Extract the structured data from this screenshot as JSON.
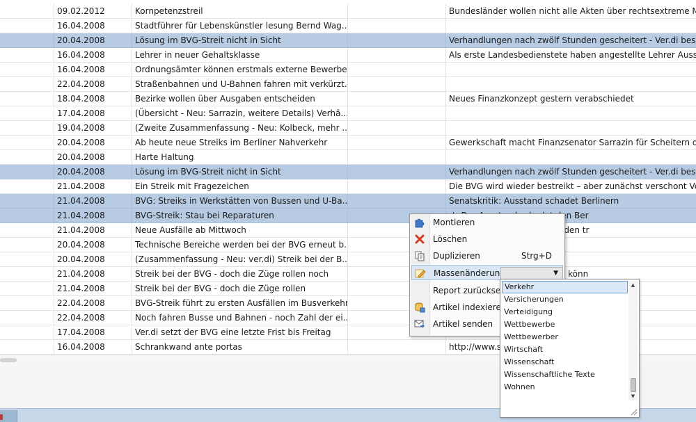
{
  "grid": {
    "rows": [
      {
        "date": "09.02.2012",
        "title": "Kornpetenzstreil",
        "extra": "",
        "note": "Bundesländer wollen nicht alle Akten über rechtsextreme Mord",
        "selected": false
      },
      {
        "date": "16.04.2008",
        "title": "Stadtführer für Lebenskünstler  lesung Bernd Wag...",
        "extra": "",
        "note": "",
        "selected": false
      },
      {
        "date": "20.04.2008",
        "title": "Lösung im BVG-Streit nicht in Sicht",
        "extra": "",
        "note": "Verhandlungen nach zwölf Stunden gescheitert - Ver.di beschu",
        "selected": true
      },
      {
        "date": "16.04.2008",
        "title": "Lehrer in neuer Gehaltsklasse",
        "extra": "",
        "note": "Als erste Landesbedienstete haben angestellte Lehrer Aussicht",
        "selected": false
      },
      {
        "date": "16.04.2008",
        "title": "Ordnungsämter können erstmals externe Bewerbe...",
        "extra": "",
        "note": "",
        "selected": false
      },
      {
        "date": "22.04.2008",
        "title": "Straßenbahnen und U-Bahnen fahren mit verkürzt...",
        "extra": "",
        "note": "",
        "selected": false
      },
      {
        "date": "18.04.2008",
        "title": "Bezirke wollen über Ausgaben entscheiden",
        "extra": "",
        "note": "Neues Finanzkonzept gestern verabschiedet",
        "selected": false
      },
      {
        "date": "17.04.2008",
        "title": "(Übersicht - Neu: Sarrazin, weitere Details) Verhä...",
        "extra": "",
        "note": "",
        "selected": false
      },
      {
        "date": "19.04.2008",
        "title": "(Zweite Zusammenfassung - Neu: Kolbeck, mehr ...",
        "extra": "",
        "note": "",
        "selected": false
      },
      {
        "date": "20.04.2008",
        "title": "Ab heute neue Streiks im Berliner Nahverkehr",
        "extra": "",
        "note": "Gewerkschaft macht Finanzsenator Sarrazin für Scheitern der",
        "selected": false
      },
      {
        "date": "20.04.2008",
        "title": "Harte Haltung",
        "extra": "",
        "note": "",
        "selected": false
      },
      {
        "date": "20.04.2008",
        "title": "Lösung im BVG-Streit nicht in Sicht",
        "extra": "",
        "note": "Verhandlungen nach zwölf Stunden gescheitert - Ver.di beschu",
        "selected": true
      },
      {
        "date": "21.04.2008",
        "title": "Ein Streik mit Fragezeichen",
        "extra": "",
        "note": "Die BVG wird wieder bestreikt – aber zunächst verschont Ver.",
        "selected": false
      },
      {
        "date": "21.04.2008",
        "title": "BVG: Streiks in Werkstätten von Bussen und U-Ba...",
        "extra": "",
        "note": "Senatskritik: Ausstand schadet Berlinern",
        "selected": true
      },
      {
        "date": "21.04.2008",
        "title": "BVG-Streik: Stau bei Reparaturen",
        "extra": "",
        "note": "rt: Der Ausstand schadet den Ber",
        "selected": true
      },
      {
        "date": "21.04.2008",
        "title": "Neue Ausfälle ab Mittwoch",
        "extra": "",
        "note": "rkstätten wird auch die Kunden tr",
        "selected": false
      },
      {
        "date": "20.04.2008",
        "title": "Technische Bereiche werden bei der BVG erneut b...",
        "extra": "",
        "note": "",
        "selected": false
      },
      {
        "date": "20.04.2008",
        "title": "(Zusammenfassung - Neu: ver.di) Streik bei der B...",
        "extra": "",
        "note": "",
        "selected": false
      },
      {
        "date": "21.04.2008",
        "title": "Streik bei der BVG - doch die Züge rollen noch",
        "extra": "",
        "note": "et im Ausstand Ab Dienstag könn",
        "selected": false
      },
      {
        "date": "21.04.2008",
        "title": "Streik bei der BVG - doch die Züge rollen",
        "extra": "",
        "note": "Dienstag könn",
        "selected": false
      },
      {
        "date": "22.04.2008",
        "title": "BVG-Streik führt zu ersten Ausfällen im Busverkehr",
        "extra": "",
        "note": "",
        "selected": false
      },
      {
        "date": "22.04.2008",
        "title": "Noch fahren Busse und Bahnen - noch  Zahl der ei...",
        "extra": "",
        "note": "",
        "selected": false
      },
      {
        "date": "17.04.2008",
        "title": "Ver.di setzt der BVG eine letzte Frist bis Freitag",
        "extra": "",
        "note": "",
        "selected": false
      },
      {
        "date": "16.04.2008",
        "title": "Schrankwand ante portas",
        "extra": "",
        "note": "http://www.s                    8,547665,00.h",
        "selected": false
      }
    ]
  },
  "context_menu": {
    "items": [
      {
        "label": "Montieren",
        "shortcut": "",
        "icon": "puzzle-icon"
      },
      {
        "label": "Löschen",
        "shortcut": "",
        "icon": "delete-x-icon"
      },
      {
        "label": "Duplizieren",
        "shortcut": "Strg+D",
        "icon": "duplicate-icon"
      },
      {
        "label": "Massenänderung",
        "shortcut": "",
        "icon": "pencil-edit-icon"
      },
      {
        "label": "Report zurücksetzen",
        "shortcut": "",
        "icon": ""
      },
      {
        "label": "Artikel indexieren",
        "shortcut": "",
        "icon": "index-database-icon"
      },
      {
        "label": "Artikel senden",
        "shortcut": "",
        "icon": "send-mail-icon"
      }
    ],
    "highlighted_index": 3
  },
  "dropdown": {
    "options": [
      "Verkehr",
      "Versicherungen",
      "Verteidigung",
      "Wettbewerbe",
      "Wettbewerber",
      "Wirtschaft",
      "Wissenschaft",
      "Wissenschaftliche Texte",
      "Wohnen"
    ],
    "current": "Verkehr"
  },
  "colors": {
    "selected_row": "#b7cbe3",
    "menu_highlight": "#dbe6f4",
    "dropdown_current": "#dbe8f7"
  }
}
